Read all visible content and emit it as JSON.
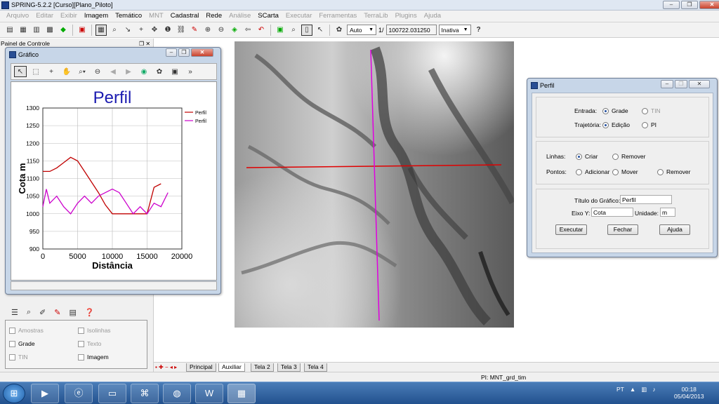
{
  "app": {
    "title": "SPRING-5.2.2 [Curso][Plano_Piloto]"
  },
  "menu": [
    {
      "label": "Arquivo",
      "enabled": false
    },
    {
      "label": "Editar",
      "enabled": false
    },
    {
      "label": "Exibir",
      "enabled": false
    },
    {
      "label": "Imagem",
      "enabled": true
    },
    {
      "label": "Temático",
      "enabled": true
    },
    {
      "label": "MNT",
      "enabled": false
    },
    {
      "label": "Cadastral",
      "enabled": true
    },
    {
      "label": "Rede",
      "enabled": true
    },
    {
      "label": "Análise",
      "enabled": false
    },
    {
      "label": "SCarta",
      "enabled": true
    },
    {
      "label": "Executar",
      "enabled": false
    },
    {
      "label": "Ferramentas",
      "enabled": false
    },
    {
      "label": "TerraLib",
      "enabled": false
    },
    {
      "label": "Plugins",
      "enabled": false
    },
    {
      "label": "Ajuda",
      "enabled": false
    }
  ],
  "toolbar": {
    "zoom_mode": "Auto",
    "scale_prefix": "1/",
    "scale_value": "100722.031250",
    "state": "Inativa",
    "help": "?"
  },
  "left_panel": {
    "title": "Painel de Controle",
    "layers": [
      {
        "label": "Amostras",
        "enabled": false
      },
      {
        "label": "Isolinhas",
        "enabled": false
      },
      {
        "label": "Grade",
        "enabled": true
      },
      {
        "label": "Texto",
        "enabled": false
      },
      {
        "label": "TIN",
        "enabled": false
      },
      {
        "label": "Imagem",
        "enabled": true
      }
    ]
  },
  "grafico": {
    "title": "Gráfico",
    "chart_title": "Perfil"
  },
  "chart_data": {
    "type": "line",
    "title": "Perfil",
    "xlabel": "Distância",
    "ylabel": "Cota m",
    "xlim": [
      0,
      20000
    ],
    "ylim": [
      900,
      1300
    ],
    "xticks": [
      "0",
      "5000",
      "10000",
      "15000",
      "20000"
    ],
    "yticks": [
      "900",
      "950",
      "1000",
      "1050",
      "1100",
      "1150",
      "1200",
      "1250",
      "1300"
    ],
    "grid": true,
    "legend_position": "top-right",
    "series": [
      {
        "name": "Perfil",
        "color": "#c00000",
        "x": [
          0,
          1000,
          2000,
          3000,
          4000,
          5000,
          6000,
          7000,
          8000,
          9000,
          10000,
          11000,
          12000,
          13000,
          14000,
          15000,
          16000,
          17000
        ],
        "y": [
          1120,
          1120,
          1130,
          1145,
          1160,
          1150,
          1120,
          1090,
          1060,
          1025,
          1000,
          1000,
          1000,
          1000,
          1000,
          1000,
          1075,
          1085
        ]
      },
      {
        "name": "Perfil",
        "color": "#cc00cc",
        "x": [
          0,
          500,
          1000,
          2000,
          3000,
          4000,
          5000,
          6000,
          7000,
          8000,
          9000,
          10000,
          11000,
          12000,
          13000,
          14000,
          15000,
          16000,
          17000,
          18000
        ],
        "y": [
          1020,
          1070,
          1030,
          1050,
          1020,
          1000,
          1030,
          1050,
          1030,
          1050,
          1060,
          1070,
          1060,
          1030,
          1000,
          1020,
          1000,
          1030,
          1020,
          1060
        ]
      }
    ]
  },
  "perfil": {
    "title": "Perfil",
    "entrada_label": "Entrada:",
    "entrada_opts": [
      "Grade",
      "TIN"
    ],
    "trajetoria_label": "Trajetória:",
    "trajetoria_opts": [
      "Edição",
      "PI"
    ],
    "linhas_label": "Linhas:",
    "linhas_opts": [
      "Criar",
      "Remover"
    ],
    "pontos_label": "Pontos:",
    "pontos_opts": [
      "Adicionar",
      "Mover",
      "Remover"
    ],
    "titulo_label": "Título do Gráfico:",
    "titulo_value": "Perfil",
    "eixoy_label": "Eixo Y:",
    "eixoy_value": "Cota",
    "unidade_label": "Unidade:",
    "unidade_value": "m",
    "buttons": [
      "Executar",
      "Fechar",
      "Ajuda"
    ]
  },
  "tabs": [
    "Principal",
    "Auxiliar",
    "Tela 2",
    "Tela 3",
    "Tela 4"
  ],
  "status": {
    "pi": "PI: MNT_grd_tim"
  },
  "taskbar": {
    "lang": "PT",
    "time": "00:18",
    "date": "05/04/2013"
  }
}
